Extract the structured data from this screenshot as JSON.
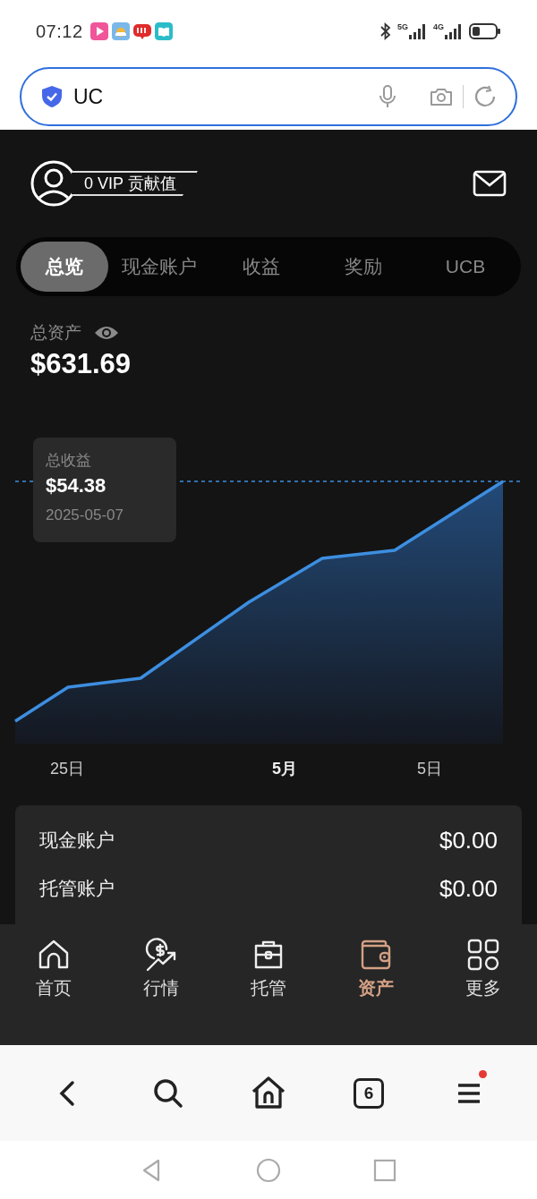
{
  "status_bar": {
    "time": "07:12",
    "network_labels": [
      "5G",
      "4G"
    ]
  },
  "address_bar": {
    "value": "UC"
  },
  "header": {
    "vip_label": "0 VIP 贡献值"
  },
  "tabs": [
    {
      "label": "总览",
      "selected": true
    },
    {
      "label": "现金账户",
      "selected": false
    },
    {
      "label": "收益",
      "selected": false
    },
    {
      "label": "奖励",
      "selected": false
    },
    {
      "label": "UCB",
      "selected": false
    }
  ],
  "total_assets": {
    "label": "总资产",
    "value": "$631.69"
  },
  "chart": {
    "tooltip": {
      "label": "总收益",
      "value": "$54.38",
      "date": "2025-05-07"
    },
    "x_labels": [
      {
        "text": "25日",
        "bold": false
      },
      {
        "text": "5月",
        "bold": true
      },
      {
        "text": "5日",
        "bold": false
      }
    ]
  },
  "accounts": [
    {
      "name": "现金账户",
      "value": "$0.00"
    },
    {
      "name": "托管账户",
      "value": "$0.00"
    }
  ],
  "bottom_nav": [
    {
      "kind": "home",
      "label": "首页",
      "selected": false
    },
    {
      "kind": "market",
      "label": "行情",
      "selected": false
    },
    {
      "kind": "custody",
      "label": "托管",
      "selected": false
    },
    {
      "kind": "wallet",
      "label": "资产",
      "selected": true
    },
    {
      "kind": "more",
      "label": "更多",
      "selected": false
    }
  ],
  "browser_toolbar": {
    "tab_count": "6",
    "menu_badge": true
  }
}
